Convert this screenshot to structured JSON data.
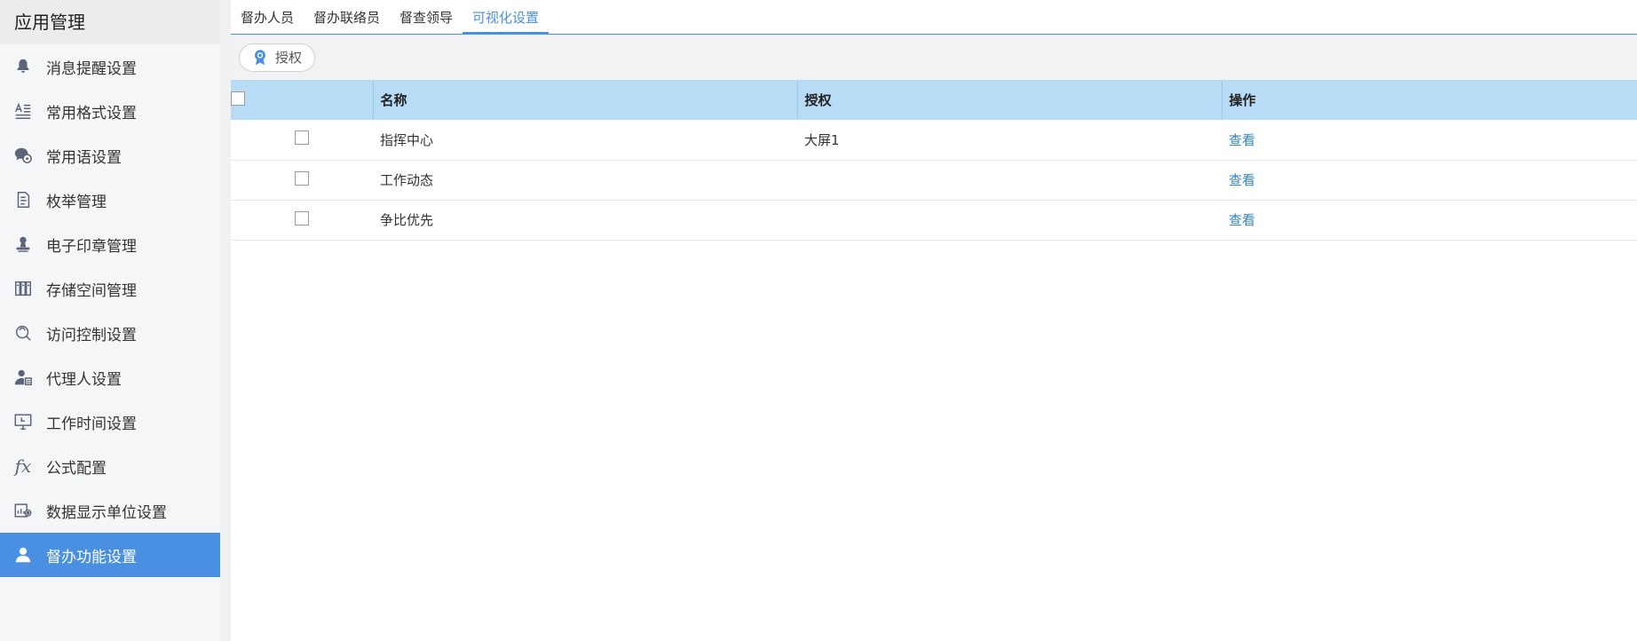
{
  "sidebar": {
    "title": "应用管理",
    "items": [
      {
        "label": "消息提醒设置",
        "icon": "bell-icon"
      },
      {
        "label": "常用格式设置",
        "icon": "text-format-icon"
      },
      {
        "label": "常用语设置",
        "icon": "chat-bubbles-icon"
      },
      {
        "label": "枚举管理",
        "icon": "document-icon"
      },
      {
        "label": "电子印章管理",
        "icon": "stamp-icon"
      },
      {
        "label": "存储空间管理",
        "icon": "storage-icon"
      },
      {
        "label": "访问控制设置",
        "icon": "access-control-icon"
      },
      {
        "label": "代理人设置",
        "icon": "agent-user-icon"
      },
      {
        "label": "工作时间设置",
        "icon": "monitor-clock-icon"
      },
      {
        "label": "公式配置",
        "icon": "fx-icon"
      },
      {
        "label": "数据显示单位设置",
        "icon": "chart-gear-icon"
      },
      {
        "label": "督办功能设置",
        "icon": "user-icon",
        "active": true
      }
    ]
  },
  "tabs": [
    {
      "label": "督办人员"
    },
    {
      "label": "督办联络员"
    },
    {
      "label": "督查领导"
    },
    {
      "label": "可视化设置",
      "active": true
    }
  ],
  "toolbar": {
    "authorize_label": "授权",
    "authorize_icon": "badge-icon"
  },
  "table": {
    "columns": [
      "名称",
      "授权",
      "操作"
    ],
    "rows": [
      {
        "name": "指挥中心",
        "auth": "大屏1",
        "action": "查看"
      },
      {
        "name": "工作动态",
        "auth": "",
        "action": "查看"
      },
      {
        "name": "争比优先",
        "auth": "",
        "action": "查看"
      }
    ]
  },
  "colors": {
    "accent": "#4a90e2",
    "header_bg": "#b8dcf6",
    "link": "#2f86d8"
  }
}
